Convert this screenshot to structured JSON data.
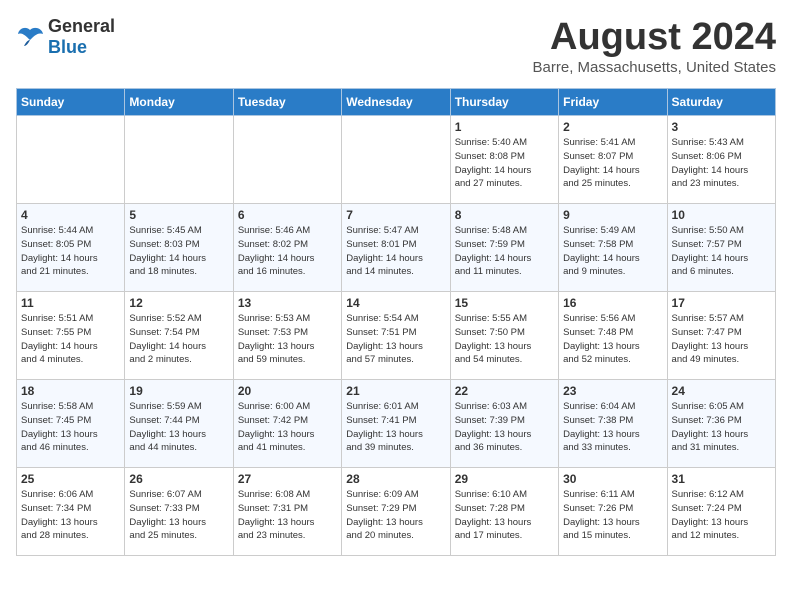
{
  "header": {
    "logo_general": "General",
    "logo_blue": "Blue",
    "month": "August 2024",
    "location": "Barre, Massachusetts, United States"
  },
  "days_of_week": [
    "Sunday",
    "Monday",
    "Tuesday",
    "Wednesday",
    "Thursday",
    "Friday",
    "Saturday"
  ],
  "weeks": [
    [
      {
        "day": "",
        "detail": ""
      },
      {
        "day": "",
        "detail": ""
      },
      {
        "day": "",
        "detail": ""
      },
      {
        "day": "",
        "detail": ""
      },
      {
        "day": "1",
        "detail": "Sunrise: 5:40 AM\nSunset: 8:08 PM\nDaylight: 14 hours\nand 27 minutes."
      },
      {
        "day": "2",
        "detail": "Sunrise: 5:41 AM\nSunset: 8:07 PM\nDaylight: 14 hours\nand 25 minutes."
      },
      {
        "day": "3",
        "detail": "Sunrise: 5:43 AM\nSunset: 8:06 PM\nDaylight: 14 hours\nand 23 minutes."
      }
    ],
    [
      {
        "day": "4",
        "detail": "Sunrise: 5:44 AM\nSunset: 8:05 PM\nDaylight: 14 hours\nand 21 minutes."
      },
      {
        "day": "5",
        "detail": "Sunrise: 5:45 AM\nSunset: 8:03 PM\nDaylight: 14 hours\nand 18 minutes."
      },
      {
        "day": "6",
        "detail": "Sunrise: 5:46 AM\nSunset: 8:02 PM\nDaylight: 14 hours\nand 16 minutes."
      },
      {
        "day": "7",
        "detail": "Sunrise: 5:47 AM\nSunset: 8:01 PM\nDaylight: 14 hours\nand 14 minutes."
      },
      {
        "day": "8",
        "detail": "Sunrise: 5:48 AM\nSunset: 7:59 PM\nDaylight: 14 hours\nand 11 minutes."
      },
      {
        "day": "9",
        "detail": "Sunrise: 5:49 AM\nSunset: 7:58 PM\nDaylight: 14 hours\nand 9 minutes."
      },
      {
        "day": "10",
        "detail": "Sunrise: 5:50 AM\nSunset: 7:57 PM\nDaylight: 14 hours\nand 6 minutes."
      }
    ],
    [
      {
        "day": "11",
        "detail": "Sunrise: 5:51 AM\nSunset: 7:55 PM\nDaylight: 14 hours\nand 4 minutes."
      },
      {
        "day": "12",
        "detail": "Sunrise: 5:52 AM\nSunset: 7:54 PM\nDaylight: 14 hours\nand 2 minutes."
      },
      {
        "day": "13",
        "detail": "Sunrise: 5:53 AM\nSunset: 7:53 PM\nDaylight: 13 hours\nand 59 minutes."
      },
      {
        "day": "14",
        "detail": "Sunrise: 5:54 AM\nSunset: 7:51 PM\nDaylight: 13 hours\nand 57 minutes."
      },
      {
        "day": "15",
        "detail": "Sunrise: 5:55 AM\nSunset: 7:50 PM\nDaylight: 13 hours\nand 54 minutes."
      },
      {
        "day": "16",
        "detail": "Sunrise: 5:56 AM\nSunset: 7:48 PM\nDaylight: 13 hours\nand 52 minutes."
      },
      {
        "day": "17",
        "detail": "Sunrise: 5:57 AM\nSunset: 7:47 PM\nDaylight: 13 hours\nand 49 minutes."
      }
    ],
    [
      {
        "day": "18",
        "detail": "Sunrise: 5:58 AM\nSunset: 7:45 PM\nDaylight: 13 hours\nand 46 minutes."
      },
      {
        "day": "19",
        "detail": "Sunrise: 5:59 AM\nSunset: 7:44 PM\nDaylight: 13 hours\nand 44 minutes."
      },
      {
        "day": "20",
        "detail": "Sunrise: 6:00 AM\nSunset: 7:42 PM\nDaylight: 13 hours\nand 41 minutes."
      },
      {
        "day": "21",
        "detail": "Sunrise: 6:01 AM\nSunset: 7:41 PM\nDaylight: 13 hours\nand 39 minutes."
      },
      {
        "day": "22",
        "detail": "Sunrise: 6:03 AM\nSunset: 7:39 PM\nDaylight: 13 hours\nand 36 minutes."
      },
      {
        "day": "23",
        "detail": "Sunrise: 6:04 AM\nSunset: 7:38 PM\nDaylight: 13 hours\nand 33 minutes."
      },
      {
        "day": "24",
        "detail": "Sunrise: 6:05 AM\nSunset: 7:36 PM\nDaylight: 13 hours\nand 31 minutes."
      }
    ],
    [
      {
        "day": "25",
        "detail": "Sunrise: 6:06 AM\nSunset: 7:34 PM\nDaylight: 13 hours\nand 28 minutes."
      },
      {
        "day": "26",
        "detail": "Sunrise: 6:07 AM\nSunset: 7:33 PM\nDaylight: 13 hours\nand 25 minutes."
      },
      {
        "day": "27",
        "detail": "Sunrise: 6:08 AM\nSunset: 7:31 PM\nDaylight: 13 hours\nand 23 minutes."
      },
      {
        "day": "28",
        "detail": "Sunrise: 6:09 AM\nSunset: 7:29 PM\nDaylight: 13 hours\nand 20 minutes."
      },
      {
        "day": "29",
        "detail": "Sunrise: 6:10 AM\nSunset: 7:28 PM\nDaylight: 13 hours\nand 17 minutes."
      },
      {
        "day": "30",
        "detail": "Sunrise: 6:11 AM\nSunset: 7:26 PM\nDaylight: 13 hours\nand 15 minutes."
      },
      {
        "day": "31",
        "detail": "Sunrise: 6:12 AM\nSunset: 7:24 PM\nDaylight: 13 hours\nand 12 minutes."
      }
    ]
  ]
}
